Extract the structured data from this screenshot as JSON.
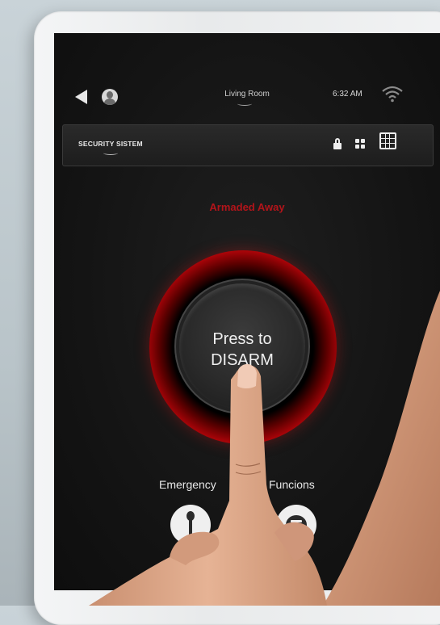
{
  "status_bar": {
    "room": "Living Room",
    "time": "6:32 AM"
  },
  "header": {
    "section_title": "SECURITY SISTEM",
    "buttons": [
      {
        "icon": "lock-icon"
      },
      {
        "icon": "grid-2x2-icon"
      },
      {
        "icon": "grid-3x3-icon"
      }
    ]
  },
  "alarm": {
    "status": "Armaded Away",
    "status_color": "#b3141a",
    "button_line1": "Press to",
    "button_line2": "DISARM",
    "ring_color": "#ff1d24"
  },
  "bottom": {
    "emergency_label": "Emergency",
    "functions_label": "Funcions"
  }
}
